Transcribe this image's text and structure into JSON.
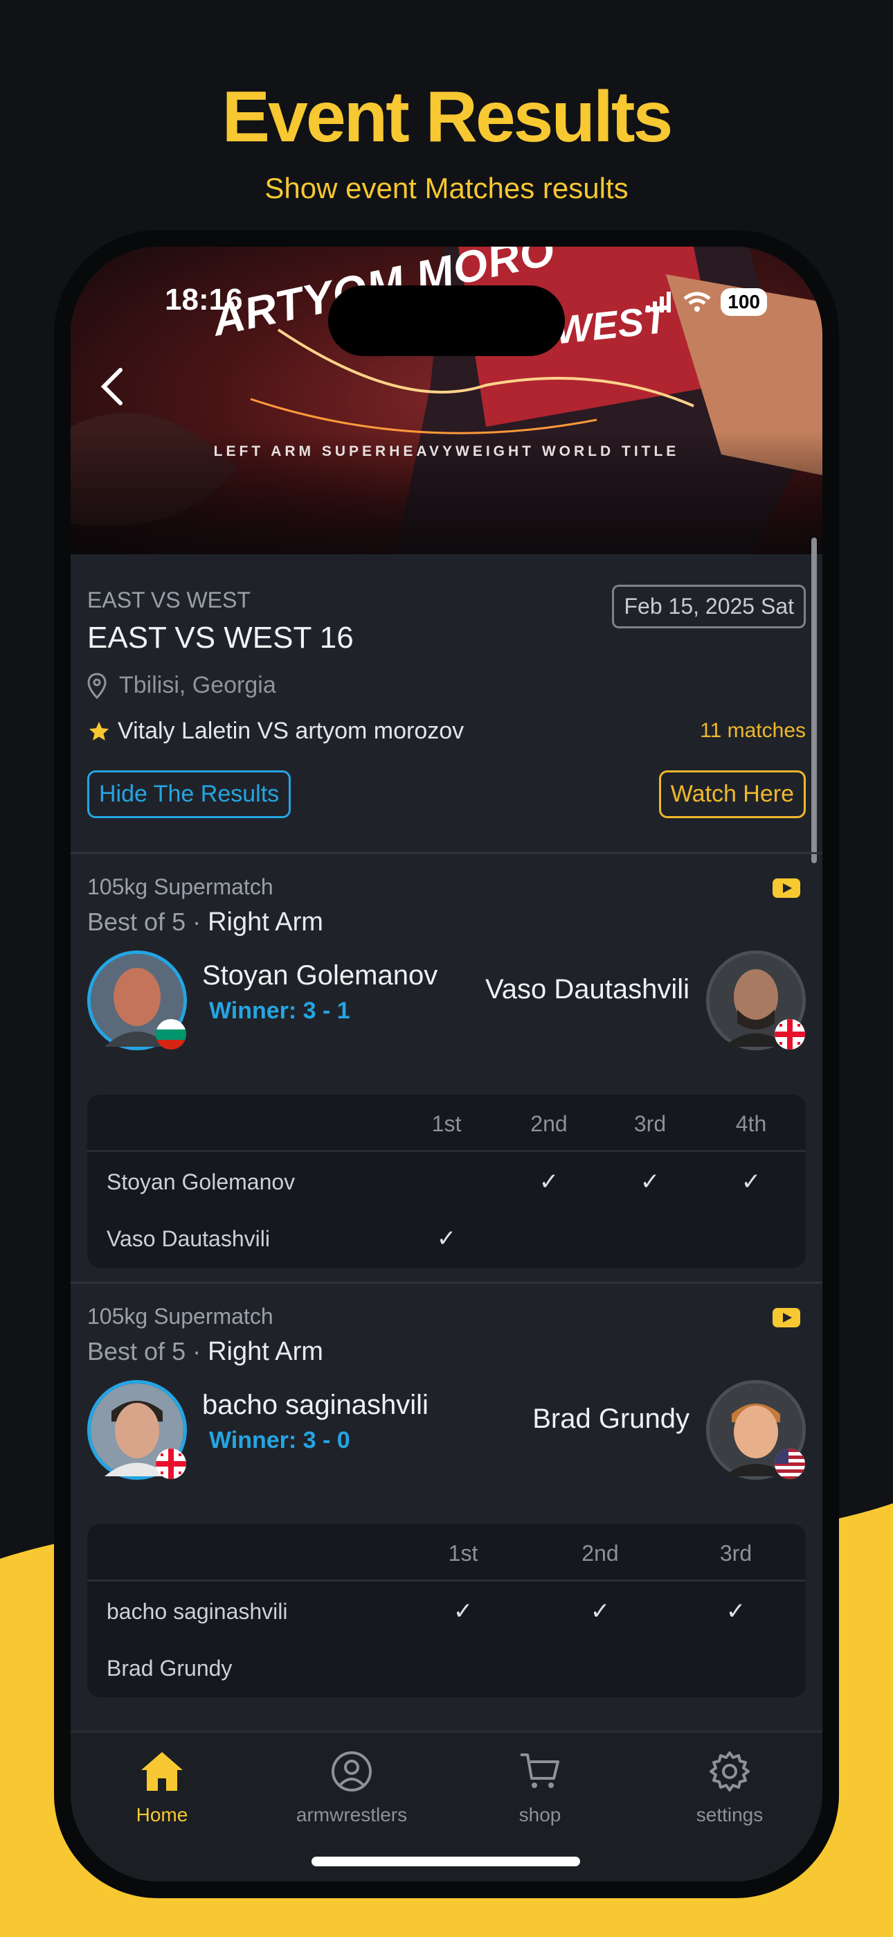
{
  "colors": {
    "accent": "#F7C831",
    "winner": "#25A5E3",
    "background": "#101216",
    "card": "#1f2329"
  },
  "promo": {
    "title": "Event Results",
    "subtitle": "Show event Matches results"
  },
  "status_bar": {
    "time": "18:16",
    "battery": "100",
    "icons": [
      "signal-icon",
      "wifi-icon",
      "battery-icon"
    ]
  },
  "hero": {
    "name_text": "ARTYOM MORO",
    "west_text": "WEST",
    "caption": "LEFT ARM SUPERHEAVYWEIGHT WORLD TITLE"
  },
  "event": {
    "overline": "EAST VS WEST",
    "title": "EAST VS WEST 16",
    "date": "Feb 15, 2025 Sat",
    "location": "Tbilisi, Georgia",
    "headline": "Vitaly Laletin VS artyom morozov",
    "match_count": "11 matches",
    "hide_button": "Hide The Results",
    "watch_button": "Watch Here"
  },
  "matches": [
    {
      "category": "105kg Supermatch",
      "format": "Best of 5 ·",
      "arm": "Right Arm",
      "left": {
        "name": "Stoyan Golemanov",
        "result": "Winner: 3 - 1",
        "flag": "bulgaria"
      },
      "right": {
        "name": "Vaso Dautashvili",
        "flag": "georgia"
      },
      "rounds": [
        "1st",
        "2nd",
        "3rd",
        "4th"
      ],
      "rows": [
        {
          "name": "Stoyan Golemanov",
          "marks": [
            "",
            "✓",
            "✓",
            "✓"
          ]
        },
        {
          "name": "Vaso Dautashvili",
          "marks": [
            "✓",
            "",
            "",
            ""
          ]
        }
      ]
    },
    {
      "category": "105kg Supermatch",
      "format": "Best of 5 ·",
      "arm": "Right Arm",
      "left": {
        "name": "bacho saginashvili",
        "result": "Winner: 3 - 0",
        "flag": "georgia"
      },
      "right": {
        "name": "Brad Grundy",
        "flag": "usa"
      },
      "rounds": [
        "1st",
        "2nd",
        "3rd"
      ],
      "rows": [
        {
          "name": "bacho saginashvili",
          "marks": [
            "✓",
            "✓",
            "✓"
          ]
        },
        {
          "name": "Brad Grundy",
          "marks": [
            "",
            "",
            ""
          ]
        }
      ]
    }
  ],
  "tabs": [
    {
      "label": "Home",
      "icon": "home-icon",
      "active": true
    },
    {
      "label": "armwrestlers",
      "icon": "user-circle-icon",
      "active": false
    },
    {
      "label": "shop",
      "icon": "cart-icon",
      "active": false
    },
    {
      "label": "settings",
      "icon": "gear-icon",
      "active": false
    }
  ]
}
